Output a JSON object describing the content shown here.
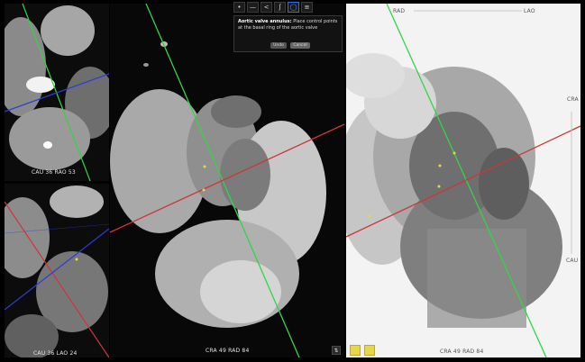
{
  "top_left_view": {
    "orientation": "CAU  36  RAO  53"
  },
  "bottom_left_view": {
    "orientation": "CAU  36  LAO  24"
  },
  "center_view": {
    "orientation": "CRA  49  RAD  84",
    "toolbar": [
      {
        "icon": "point-icon",
        "glyph": "•"
      },
      {
        "icon": "measure-icon",
        "glyph": "—"
      },
      {
        "icon": "share-icon",
        "glyph": "<"
      },
      {
        "icon": "curve-icon",
        "glyph": "ʃ"
      },
      {
        "icon": "ring-icon",
        "glyph": "◯"
      },
      {
        "icon": "menu-icon",
        "glyph": "≡"
      }
    ],
    "tooltip": {
      "title": "Aortic valve annulus:",
      "body": "Place control points at the basal ring of the aortic valve",
      "undo_label": "Undo",
      "cancel_label": "Cancel"
    }
  },
  "right_view": {
    "top_left": "RAD",
    "top_right": "LAO",
    "side_top": "CRA",
    "side_bottom": "CAU",
    "orientation": "CRA  49  RAD  84"
  },
  "colors": {
    "green_line": "#36d24a",
    "red_line": "#d1333a",
    "blue_line": "#2d3cd6",
    "marker": "#e6d84a"
  }
}
